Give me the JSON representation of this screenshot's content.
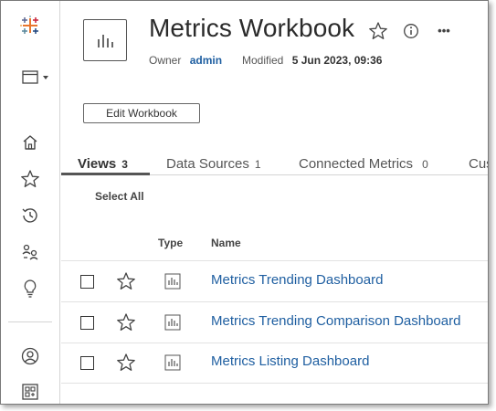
{
  "sidebar": {
    "items": [
      {
        "name": "tableau-logo-icon"
      },
      {
        "name": "browse-menu-icon"
      },
      {
        "name": "home-icon"
      },
      {
        "name": "favorites-icon"
      },
      {
        "name": "recents-icon"
      },
      {
        "name": "shared-with-me-icon"
      },
      {
        "name": "recommendations-icon"
      },
      {
        "name": "personal-space-icon"
      },
      {
        "name": "collections-icon"
      }
    ]
  },
  "header": {
    "title": "Metrics Workbook",
    "owner_label": "Owner",
    "owner_value": "admin",
    "modified_label": "Modified",
    "modified_value": "5 Jun 2023, 09:36",
    "more_label": "•••"
  },
  "actions": {
    "edit_workbook": "Edit Workbook"
  },
  "tabs": [
    {
      "label": "Views",
      "count": "3",
      "active": true
    },
    {
      "label": "Data Sources",
      "count": "1",
      "active": false
    },
    {
      "label": "Connected Metrics",
      "count": "0",
      "active": false
    },
    {
      "label": "Cus",
      "count": "",
      "active": false
    }
  ],
  "list": {
    "select_all": "Select All",
    "columns": {
      "type": "Type",
      "name": "Name"
    },
    "rows": [
      {
        "name": "Metrics Trending Dashboard"
      },
      {
        "name": "Metrics Trending Comparison Dashboard"
      },
      {
        "name": "Metrics Listing Dashboard"
      }
    ]
  },
  "colors": {
    "link": "#1f5fa1",
    "text": "#333333",
    "border": "#d4d4d4"
  }
}
